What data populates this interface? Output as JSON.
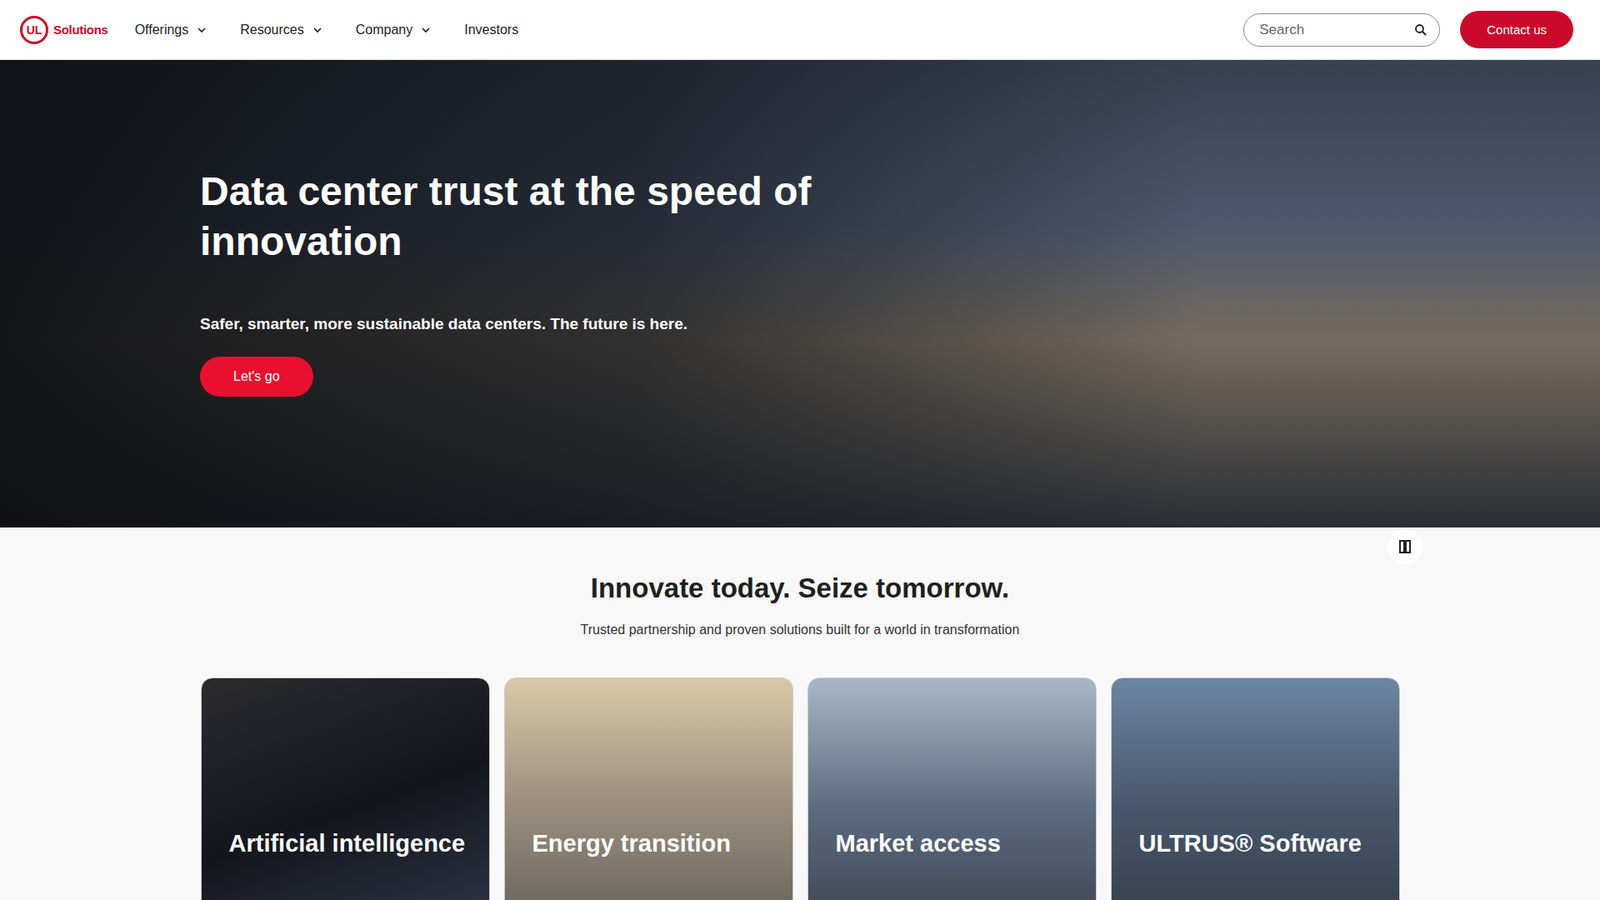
{
  "header": {
    "logo": {
      "mark": "UL",
      "name": "Solutions"
    },
    "nav": [
      {
        "label": "Offerings",
        "dropdown": true
      },
      {
        "label": "Resources",
        "dropdown": true
      },
      {
        "label": "Company",
        "dropdown": true
      },
      {
        "label": "Investors",
        "dropdown": false
      }
    ],
    "search": {
      "placeholder": "Search"
    },
    "contact_button": "Contact us"
  },
  "hero": {
    "title": "Data center trust at the speed of innovation",
    "subtitle": "Safer, smarter, more sustainable data centers. The future is here.",
    "button": "Let's go",
    "playing": true
  },
  "section": {
    "title": "Innovate today. Seize tomorrow.",
    "subtitle": "Trusted partnership and proven solutions built for a world in transformation",
    "cards": [
      {
        "title": "Artificial intelligence"
      },
      {
        "title": "Energy transition"
      },
      {
        "title": "Market access"
      },
      {
        "title": "ULTRUS® Software"
      }
    ]
  }
}
